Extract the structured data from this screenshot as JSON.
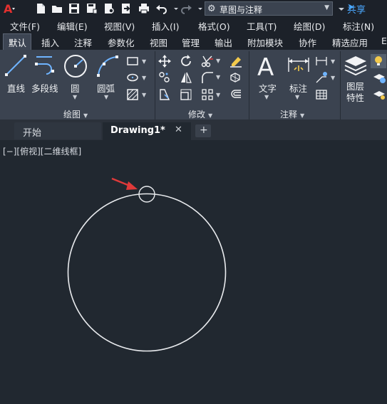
{
  "workspace": {
    "name": "草图与注释"
  },
  "share_label": "共享",
  "menus": [
    "文件(F)",
    "编辑(E)",
    "视图(V)",
    "插入(I)",
    "格式(O)",
    "工具(T)",
    "绘图(D)",
    "标注(N)"
  ],
  "ribbon_tabs": [
    "默认",
    "插入",
    "注释",
    "参数化",
    "视图",
    "管理",
    "输出",
    "附加模块",
    "协作",
    "精选应用",
    "E"
  ],
  "draw_panel": {
    "title": "绘图",
    "tools": [
      "直线",
      "多段线",
      "圆",
      "圆弧"
    ]
  },
  "modify_panel": {
    "title": "修改"
  },
  "annotation_panel": {
    "title": "注释",
    "tools": [
      "文字",
      "标注"
    ]
  },
  "layers_panel": {
    "tool": "图层\n特性"
  },
  "file_tabs": {
    "start": "开始",
    "drawing": "Drawing1*",
    "close": "✕",
    "new": "+"
  },
  "viewport": {
    "controls": "[−][俯视][二维线框]",
    "accent_color": "#e03a3a"
  }
}
